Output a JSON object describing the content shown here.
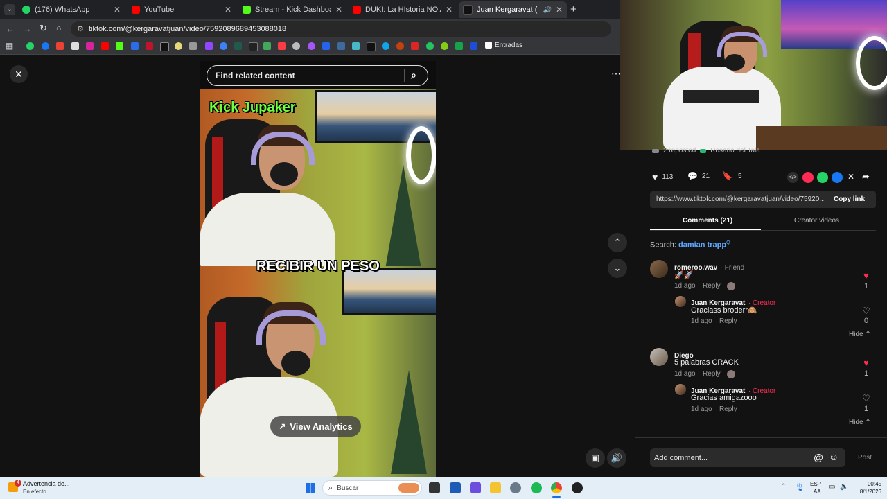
{
  "browser": {
    "tabs": [
      {
        "title": "(176) WhatsApp",
        "color": "#25d366"
      },
      {
        "title": "YouTube",
        "color": "#ff0000"
      },
      {
        "title": "Stream - Kick Dashboard",
        "color": "#53fc18"
      },
      {
        "title": "DUKI: La HIstoria NO AUTORIZADA",
        "color": "#ff0000"
      },
      {
        "title": "Juan Kergaravat (@kergaravatjuan)",
        "color": "#000000"
      }
    ],
    "new_tab": "+",
    "url": "tiktok.com/@kergaravatjuan/video/7592089689453088018",
    "bookmarks_label": "Entradas"
  },
  "video_panel": {
    "search_placeholder": "Find related content",
    "caption_top": "Kick Jupaker",
    "caption_mid": "RECIBIR UN PESO",
    "analytics_label": "View Analytics"
  },
  "stream_overlay": {
    "reposted": "2 reposted",
    "repost_user": "Rosario del Tala"
  },
  "actions": {
    "likes": "113",
    "comments": "21",
    "saves": "5"
  },
  "share": {
    "link": "https://www.tiktok.com/@kergaravatjuan/video/75920...",
    "copy_label": "Copy link"
  },
  "tabs": {
    "comments": "Comments (21)",
    "creator_videos": "Creator videos"
  },
  "search_hint": {
    "prefix": "Search:",
    "term": "damian trapp",
    "suffix": "Q"
  },
  "comments": [
    {
      "user": "romeroo.wav",
      "tag": "· Friend",
      "text": "🚀🚀",
      "time": "1d ago",
      "reply": "Reply",
      "likes": "1",
      "liked": true,
      "reply_item": {
        "user": "Juan Kergaravat",
        "tag": "· Creator",
        "text": "Graciass broderr🙈",
        "time": "1d ago",
        "reply": "Reply",
        "likes": "0",
        "liked": false
      },
      "hide": "Hide"
    },
    {
      "user": "Diego",
      "tag": "",
      "text": "5 palabras CRACK",
      "time": "1d ago",
      "reply": "Reply",
      "likes": "1",
      "liked": true,
      "reply_item": {
        "user": "Juan Kergaravat",
        "tag": "· Creator",
        "text": "Gracias amigazooo",
        "time": "1d ago",
        "reply": "Reply",
        "likes": "1",
        "liked": false
      },
      "hide": "Hide"
    }
  ],
  "composer": {
    "placeholder": "Add comment...",
    "post_label": "Post"
  },
  "taskbar": {
    "notification_title": "Advertencia de...",
    "notification_sub": "En efecto",
    "notification_badge": "4",
    "search_label": "Buscar",
    "lang_top": "ESP",
    "lang_bottom": "LAA",
    "time": "00:45",
    "date": "8/1/2026"
  },
  "colors": {
    "like_red": "#fe2c55",
    "accent_blue": "#5ea8ff",
    "kick_green": "#53fc18"
  }
}
